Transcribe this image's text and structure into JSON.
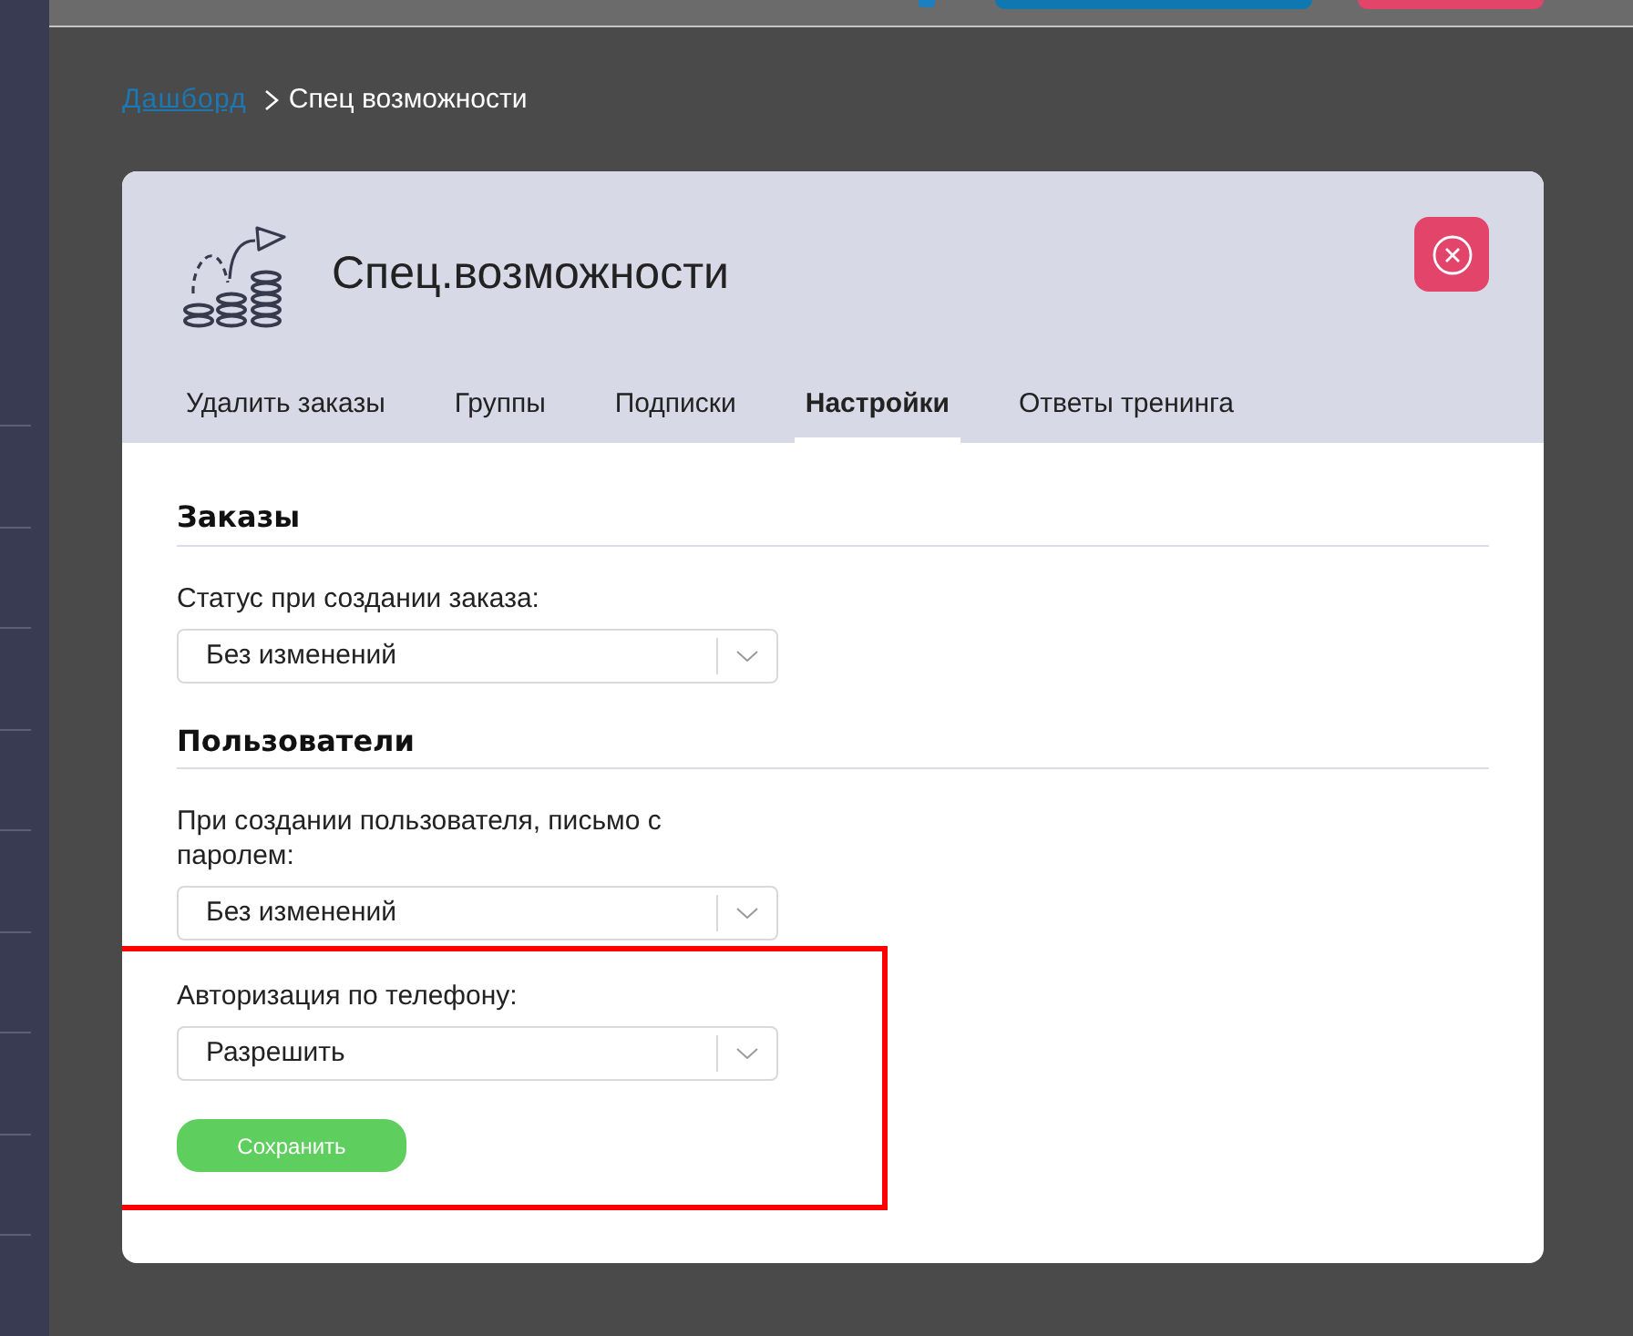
{
  "breadcrumb": [
    {
      "label": "Дашборд",
      "kind": "link"
    },
    {
      "label": "Спец возможности",
      "kind": "current"
    }
  ],
  "panel": {
    "title": "Спец.возможности",
    "tabs": [
      {
        "label": "Удалить заказы",
        "selected": false
      },
      {
        "label": "Группы",
        "selected": false
      },
      {
        "label": "Подписки",
        "selected": false
      },
      {
        "label": "Настройки",
        "selected": true
      },
      {
        "label": "Ответы тренинга",
        "selected": false
      }
    ]
  },
  "sections": [
    {
      "heading": "Заказы",
      "fields": [
        {
          "label": "Статус при создании заказа:",
          "value": "Без изменений"
        }
      ]
    },
    {
      "heading": "Пользователи",
      "fields": [
        {
          "label": "При создании пользователя, письмо с паролем:",
          "value": "Без изменений"
        }
      ]
    }
  ],
  "highlight_frame": {
    "fields": [
      {
        "label": "Авторизация по телефону:",
        "value": "Разрешить"
      }
    ],
    "save_button": "Сохранить"
  }
}
